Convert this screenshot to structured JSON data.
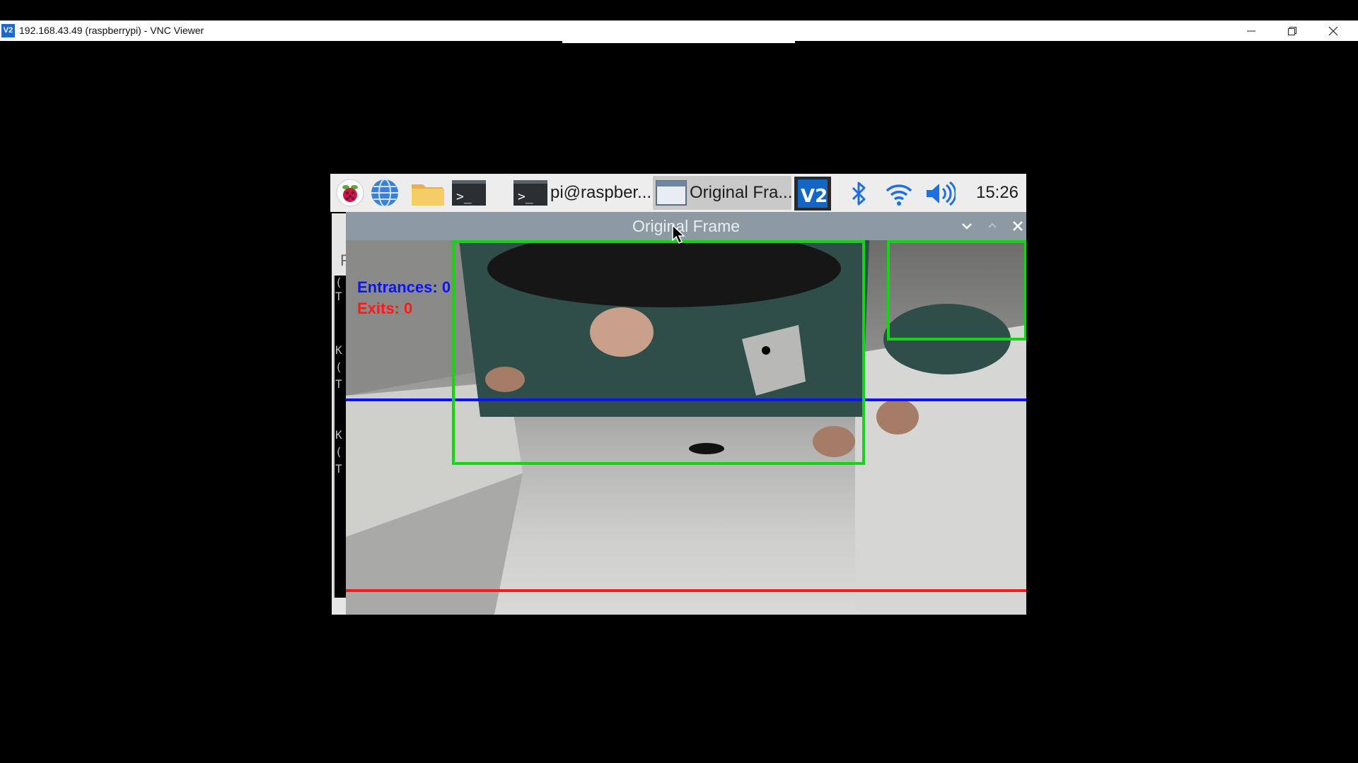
{
  "vnc_window": {
    "title": "192.168.43.49 (raspberrypi) - VNC Viewer",
    "logo_text": "V2"
  },
  "taskbar": {
    "terminal_task_label": "pi@raspber...",
    "frame_task_label": "Original Fra...",
    "clock": "15:26"
  },
  "background_terminal": {
    "visible_chars": [
      "F",
      "(",
      "T",
      "K",
      "(",
      "T",
      "K",
      "(",
      "T"
    ]
  },
  "frame_window": {
    "title": "Original Frame"
  },
  "overlay": {
    "entrances_text": "Entrances: 0",
    "exits_text": "Exits: 0",
    "entrance_color": "#0a14ff",
    "exit_color": "#ff1a1a",
    "box_color": "#12d612"
  }
}
